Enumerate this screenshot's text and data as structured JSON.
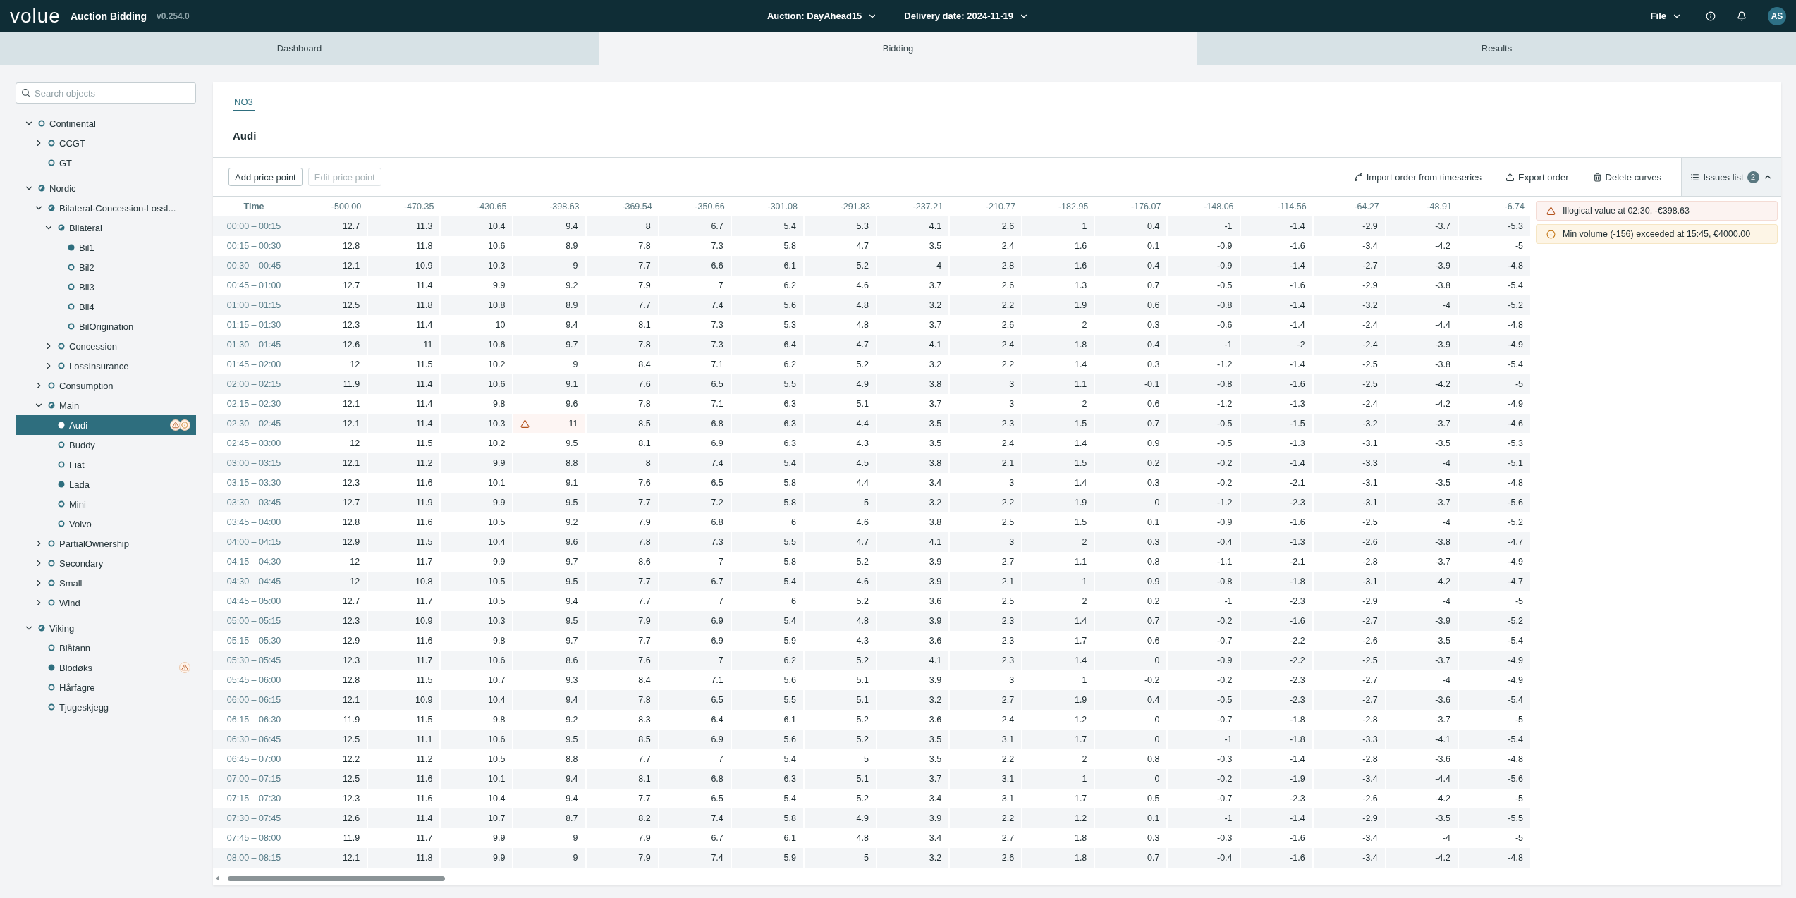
{
  "app": {
    "logo": "volue",
    "title": "Auction Bidding",
    "version": "v0.254.0"
  },
  "header": {
    "selectors": [
      {
        "label": "Auction: DayAhead15"
      },
      {
        "label": "Delivery date: 2024-11-19"
      }
    ],
    "menu": "File",
    "avatar": "AS"
  },
  "tabs": [
    {
      "label": "Dashboard",
      "selected": false
    },
    {
      "label": "Bidding",
      "selected": true
    },
    {
      "label": "Results",
      "selected": false
    }
  ],
  "sidebar": {
    "search": {
      "placeholder": "Search objects"
    },
    "tree": [
      {
        "label": "Continental",
        "kind": "empty",
        "expanded": true,
        "selected": false,
        "children": [
          {
            "label": "CCGT",
            "kind": "empty",
            "expanded": false,
            "selected": false
          },
          {
            "label": "GT",
            "kind": "empty",
            "selected": false
          }
        ]
      },
      {
        "label": "Nordic",
        "kind": "partial",
        "expanded": true,
        "selected": false,
        "children": [
          {
            "label": "Bilateral-Concession-LossI...",
            "kind": "partial",
            "expanded": true,
            "selected": false,
            "children": [
              {
                "label": "Bilateral",
                "kind": "partial",
                "expanded": true,
                "selected": false,
                "children": [
                  {
                    "label": "Bil1",
                    "kind": "full",
                    "selected": false
                  },
                  {
                    "label": "Bil2",
                    "kind": "empty",
                    "selected": false
                  },
                  {
                    "label": "Bil3",
                    "kind": "empty",
                    "selected": false
                  },
                  {
                    "label": "Bil4",
                    "kind": "empty",
                    "selected": false
                  },
                  {
                    "label": "BilOrigination",
                    "kind": "empty",
                    "selected": false
                  }
                ]
              },
              {
                "label": "Concession",
                "kind": "empty",
                "expanded": false,
                "selected": false
              },
              {
                "label": "LossInsurance",
                "kind": "empty",
                "expanded": false,
                "selected": false
              }
            ]
          },
          {
            "label": "Consumption",
            "kind": "empty",
            "expanded": false,
            "selected": false
          },
          {
            "label": "Main",
            "kind": "partial",
            "expanded": true,
            "selected": false,
            "children": [
              {
                "label": "Audi",
                "kind": "full",
                "selected": true,
                "issues": [
                  {
                    "kind": "warning"
                  },
                  {
                    "kind": "info"
                  }
                ]
              },
              {
                "label": "Buddy",
                "kind": "empty",
                "selected": false
              },
              {
                "label": "Fiat",
                "kind": "empty",
                "selected": false
              },
              {
                "label": "Lada",
                "kind": "full",
                "selected": false
              },
              {
                "label": "Mini",
                "kind": "empty",
                "selected": false
              },
              {
                "label": "Volvo",
                "kind": "empty",
                "selected": false
              }
            ]
          },
          {
            "label": "PartialOwnership",
            "kind": "empty",
            "expanded": false,
            "selected": false
          },
          {
            "label": "Secondary",
            "kind": "empty",
            "expanded": false,
            "selected": false
          },
          {
            "label": "Small",
            "kind": "empty",
            "expanded": false,
            "selected": false
          },
          {
            "label": "Wind",
            "kind": "empty",
            "expanded": false,
            "selected": false
          }
        ]
      },
      {
        "label": "Viking",
        "kind": "partial",
        "expanded": true,
        "selected": false,
        "children": [
          {
            "label": "Blåtann",
            "kind": "empty",
            "selected": false
          },
          {
            "label": "Blodøks",
            "kind": "full",
            "selected": false,
            "issues": [
              {
                "kind": "warning"
              }
            ]
          },
          {
            "label": "Hårfagre",
            "kind": "empty",
            "selected": false
          },
          {
            "label": "Tjugeskjegg",
            "kind": "empty",
            "selected": false
          }
        ]
      }
    ]
  },
  "panel": {
    "area_tabs": [
      {
        "label": "NO3",
        "selected": true
      }
    ],
    "heading": "Audi",
    "toolbar": {
      "buttons": [
        {
          "label": "Add price point",
          "disabled": false
        },
        {
          "label": "Edit price point",
          "disabled": true
        }
      ],
      "actions": [
        {
          "kind": "import",
          "label": "Import order from timeseries"
        },
        {
          "kind": "export",
          "label": "Export order"
        },
        {
          "kind": "delete",
          "label": "Delete curves"
        }
      ],
      "issues_toggle": {
        "label": "Issues list",
        "count": "2",
        "expanded": true
      }
    },
    "table": {
      "columns": [
        "Time",
        "-500.00",
        "-470.35",
        "-430.65",
        "-398.63",
        "-369.54",
        "-350.66",
        "-301.08",
        "-291.83",
        "-237.21",
        "-210.77",
        "-182.95",
        "-176.07",
        "-148.06",
        "-114.56",
        "-64.27",
        "-48.91",
        "-6.74"
      ],
      "rows": [
        {
          "cells": [
            "00:00 – 00:15",
            "12.7",
            "11.3",
            "10.4",
            "9.4",
            "8",
            "6.7",
            "5.4",
            "5.3",
            "4.1",
            "2.6",
            "1",
            "0.4",
            "-1",
            "-1.4",
            "-2.9",
            "-3.7",
            "-5.3"
          ]
        },
        {
          "cells": [
            "00:15 – 00:30",
            "12.8",
            "11.8",
            "10.6",
            "8.9",
            "7.8",
            "7.3",
            "5.8",
            "4.7",
            "3.5",
            "2.4",
            "1.6",
            "0.1",
            "-0.9",
            "-1.6",
            "-3.4",
            "-4.2",
            "-5"
          ]
        },
        {
          "cells": [
            "00:30 – 00:45",
            "12.1",
            "10.9",
            "10.3",
            "9",
            "7.7",
            "6.6",
            "6.1",
            "5.2",
            "4",
            "2.8",
            "1.6",
            "0.4",
            "-0.9",
            "-1.4",
            "-2.7",
            "-3.9",
            "-4.8"
          ]
        },
        {
          "cells": [
            "00:45 – 01:00",
            "12.7",
            "11.4",
            "9.9",
            "9.2",
            "7.9",
            "7",
            "6.2",
            "4.6",
            "3.7",
            "2.6",
            "1.3",
            "0.7",
            "-0.5",
            "-1.6",
            "-2.9",
            "-3.8",
            "-5.4"
          ]
        },
        {
          "cells": [
            "01:00 – 01:15",
            "12.5",
            "11.8",
            "10.8",
            "8.9",
            "7.7",
            "7.4",
            "5.6",
            "4.8",
            "3.2",
            "2.2",
            "1.9",
            "0.6",
            "-0.8",
            "-1.4",
            "-3.2",
            "-4",
            "-5.2"
          ]
        },
        {
          "cells": [
            "01:15 – 01:30",
            "12.3",
            "11.4",
            "10",
            "9.4",
            "8.1",
            "7.3",
            "5.3",
            "4.8",
            "3.7",
            "2.6",
            "2",
            "0.3",
            "-0.6",
            "-1.4",
            "-2.4",
            "-4.4",
            "-4.8"
          ]
        },
        {
          "cells": [
            "01:30 – 01:45",
            "12.6",
            "11",
            "10.6",
            "9.7",
            "7.8",
            "7.3",
            "6.4",
            "4.7",
            "4.1",
            "2.4",
            "1.8",
            "0.4",
            "-1",
            "-2",
            "-2.4",
            "-3.9",
            "-4.9"
          ]
        },
        {
          "cells": [
            "01:45 – 02:00",
            "12",
            "11.5",
            "10.2",
            "9",
            "8.4",
            "7.1",
            "6.2",
            "5.2",
            "3.2",
            "2.2",
            "1.4",
            "0.3",
            "-1.2",
            "-1.4",
            "-2.5",
            "-3.8",
            "-5.4"
          ]
        },
        {
          "cells": [
            "02:00 – 02:15",
            "11.9",
            "11.4",
            "10.6",
            "9.1",
            "7.6",
            "6.5",
            "5.5",
            "4.9",
            "3.8",
            "3",
            "1.1",
            "-0.1",
            "-0.8",
            "-1.6",
            "-2.5",
            "-4.2",
            "-5"
          ]
        },
        {
          "cells": [
            "02:15 – 02:30",
            "12.1",
            "11.4",
            "9.8",
            "9.6",
            "7.8",
            "7.1",
            "6.3",
            "5.1",
            "3.7",
            "3",
            "2",
            "0.6",
            "-1.2",
            "-1.3",
            "-2.4",
            "-4.2",
            "-4.9"
          ]
        },
        {
          "cells": [
            "02:30 – 02:45",
            "12.1",
            "11.4",
            "10.3",
            {
              "value": "11",
              "kind": "warning"
            },
            "8.5",
            "6.8",
            "6.3",
            "4.4",
            "3.5",
            "2.3",
            "1.5",
            "0.7",
            "-0.5",
            "-1.5",
            "-3.2",
            "-3.7",
            "-4.6"
          ]
        },
        {
          "cells": [
            "02:45 – 03:00",
            "12",
            "11.5",
            "10.2",
            "9.5",
            "8.1",
            "6.9",
            "6.3",
            "4.3",
            "3.5",
            "2.4",
            "1.4",
            "0.9",
            "-0.5",
            "-1.3",
            "-3.1",
            "-3.5",
            "-5.3"
          ]
        },
        {
          "cells": [
            "03:00 – 03:15",
            "12.1",
            "11.2",
            "9.9",
            "8.8",
            "8",
            "7.4",
            "5.4",
            "4.5",
            "3.8",
            "2.1",
            "1.5",
            "0.2",
            "-0.2",
            "-1.4",
            "-3.3",
            "-4",
            "-5.1"
          ]
        },
        {
          "cells": [
            "03:15 – 03:30",
            "12.3",
            "11.6",
            "10.1",
            "9.1",
            "7.6",
            "6.5",
            "5.8",
            "4.4",
            "3.4",
            "3",
            "1.4",
            "0.3",
            "-0.2",
            "-2.1",
            "-3.1",
            "-3.5",
            "-4.8"
          ]
        },
        {
          "cells": [
            "03:30 – 03:45",
            "12.7",
            "11.9",
            "9.9",
            "9.5",
            "7.7",
            "7.2",
            "5.8",
            "5",
            "3.2",
            "2.2",
            "1.9",
            "0",
            "-1.2",
            "-2.3",
            "-3.1",
            "-3.7",
            "-5.6"
          ]
        },
        {
          "cells": [
            "03:45 – 04:00",
            "12.8",
            "11.6",
            "10.5",
            "9.2",
            "7.9",
            "6.8",
            "6",
            "4.6",
            "3.8",
            "2.5",
            "1.5",
            "0.1",
            "-0.9",
            "-1.6",
            "-2.5",
            "-4",
            "-5.2"
          ]
        },
        {
          "cells": [
            "04:00 – 04:15",
            "12.9",
            "11.5",
            "10.4",
            "9.6",
            "7.8",
            "7.3",
            "5.5",
            "4.7",
            "4.1",
            "3",
            "2",
            "0.3",
            "-0.4",
            "-1.3",
            "-2.6",
            "-3.8",
            "-4.7"
          ]
        },
        {
          "cells": [
            "04:15 – 04:30",
            "12",
            "11.7",
            "9.9",
            "9.7",
            "8.6",
            "7",
            "5.8",
            "5.2",
            "3.9",
            "2.7",
            "1.1",
            "0.8",
            "-1.1",
            "-2.1",
            "-2.8",
            "-3.7",
            "-4.9"
          ]
        },
        {
          "cells": [
            "04:30 – 04:45",
            "12",
            "10.8",
            "10.5",
            "9.5",
            "7.7",
            "6.7",
            "5.4",
            "4.6",
            "3.9",
            "2.1",
            "1",
            "0.9",
            "-0.8",
            "-1.8",
            "-3.1",
            "-4.2",
            "-4.7"
          ]
        },
        {
          "cells": [
            "04:45 – 05:00",
            "12.7",
            "11.7",
            "10.5",
            "9.4",
            "7.7",
            "7",
            "6",
            "5.2",
            "3.6",
            "2.5",
            "2",
            "0.2",
            "-1",
            "-2.3",
            "-2.9",
            "-4",
            "-5"
          ]
        },
        {
          "cells": [
            "05:00 – 05:15",
            "12.3",
            "10.9",
            "10.3",
            "9.5",
            "7.9",
            "6.9",
            "5.4",
            "4.8",
            "3.9",
            "2.3",
            "1.4",
            "0.7",
            "-0.2",
            "-1.6",
            "-2.7",
            "-3.9",
            "-5.2"
          ]
        },
        {
          "cells": [
            "05:15 – 05:30",
            "12.9",
            "11.6",
            "9.8",
            "9.7",
            "7.7",
            "6.9",
            "5.9",
            "4.3",
            "3.6",
            "2.3",
            "1.7",
            "0.6",
            "-0.7",
            "-2.2",
            "-2.6",
            "-3.5",
            "-5.4"
          ]
        },
        {
          "cells": [
            "05:30 – 05:45",
            "12.3",
            "11.7",
            "10.6",
            "8.6",
            "7.6",
            "7",
            "6.2",
            "5.2",
            "4.1",
            "2.3",
            "1.4",
            "0",
            "-0.9",
            "-2.2",
            "-2.5",
            "-3.7",
            "-4.9"
          ]
        },
        {
          "cells": [
            "05:45 – 06:00",
            "12.8",
            "11.5",
            "10.7",
            "9.3",
            "8.4",
            "7.1",
            "5.6",
            "5.1",
            "3.9",
            "3",
            "1",
            "-0.2",
            "-0.2",
            "-2.3",
            "-2.7",
            "-4",
            "-4.9"
          ]
        },
        {
          "cells": [
            "06:00 – 06:15",
            "12.1",
            "10.9",
            "10.4",
            "9.4",
            "7.8",
            "6.5",
            "5.5",
            "5.1",
            "3.2",
            "2.7",
            "1.9",
            "0.4",
            "-0.5",
            "-2.3",
            "-2.7",
            "-3.6",
            "-5.4"
          ]
        },
        {
          "cells": [
            "06:15 – 06:30",
            "11.9",
            "11.5",
            "9.8",
            "9.2",
            "8.3",
            "6.4",
            "6.1",
            "5.2",
            "3.6",
            "2.4",
            "1.2",
            "0",
            "-0.7",
            "-1.8",
            "-2.8",
            "-3.7",
            "-5"
          ]
        },
        {
          "cells": [
            "06:30 – 06:45",
            "12.5",
            "11.1",
            "10.6",
            "9.5",
            "8.5",
            "6.9",
            "5.6",
            "5.2",
            "3.5",
            "3.1",
            "1.7",
            "0",
            "-1",
            "-1.8",
            "-3.3",
            "-4.1",
            "-5.4"
          ]
        },
        {
          "cells": [
            "06:45 – 07:00",
            "12.2",
            "11.2",
            "10.5",
            "8.8",
            "7.7",
            "7",
            "5.4",
            "5",
            "3.5",
            "2.2",
            "2",
            "0.8",
            "-0.3",
            "-1.4",
            "-2.8",
            "-3.6",
            "-4.8"
          ]
        },
        {
          "cells": [
            "07:00 – 07:15",
            "12.5",
            "11.6",
            "10.1",
            "9.4",
            "8.1",
            "6.8",
            "6.3",
            "5.1",
            "3.7",
            "3.1",
            "1",
            "0",
            "-0.2",
            "-1.9",
            "-3.4",
            "-4.4",
            "-5.6"
          ]
        },
        {
          "cells": [
            "07:15 – 07:30",
            "12.3",
            "11.6",
            "10.4",
            "9.4",
            "7.7",
            "6.5",
            "5.4",
            "5.2",
            "3.4",
            "3.1",
            "1.7",
            "0.5",
            "-0.7",
            "-2.3",
            "-2.6",
            "-4.2",
            "-5"
          ]
        },
        {
          "cells": [
            "07:30 – 07:45",
            "12.6",
            "11.4",
            "10.7",
            "8.7",
            "8.2",
            "7.4",
            "5.8",
            "4.9",
            "3.9",
            "2.2",
            "1.2",
            "0.1",
            "-1",
            "-1.4",
            "-2.9",
            "-3.5",
            "-5.5"
          ]
        },
        {
          "cells": [
            "07:45 – 08:00",
            "11.9",
            "11.7",
            "9.9",
            "9",
            "7.9",
            "6.7",
            "6.1",
            "4.8",
            "3.4",
            "2.7",
            "1.8",
            "0.3",
            "-0.3",
            "-1.6",
            "-3.4",
            "-4",
            "-5"
          ]
        },
        {
          "cells": [
            "08:00 – 08:15",
            "12.1",
            "11.8",
            "9.9",
            "9",
            "7.9",
            "7.4",
            "5.9",
            "5",
            "3.2",
            "2.6",
            "1.8",
            "0.7",
            "-0.4",
            "-1.6",
            "-3.4",
            "-4.2",
            "-4.8"
          ]
        }
      ]
    },
    "issues": [
      {
        "kind": "warning",
        "text": "Illogical value at 02:30, -€398.63"
      },
      {
        "kind": "info",
        "text": "Min volume (-156) exceeded at 15:45, €4000.00"
      }
    ]
  }
}
